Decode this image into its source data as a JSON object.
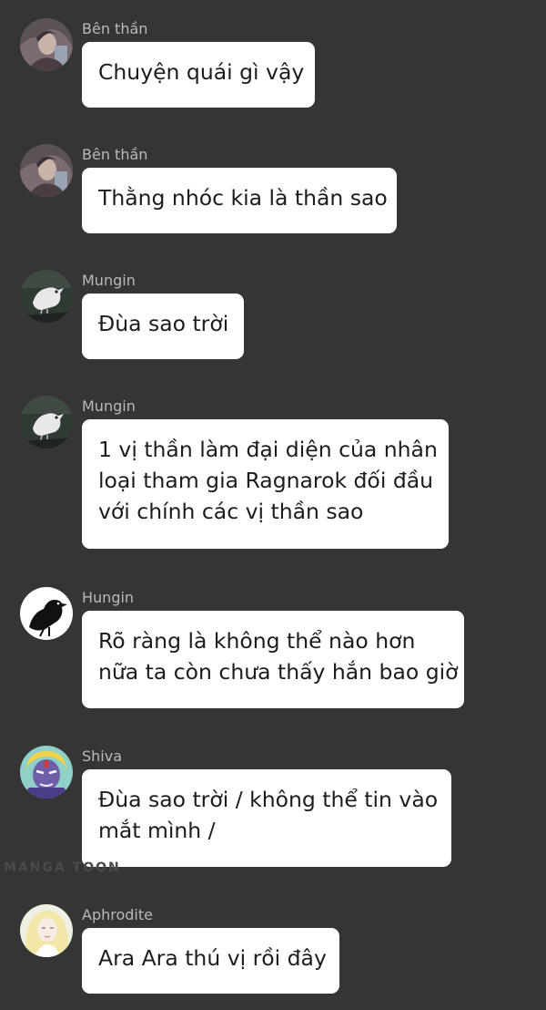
{
  "messages": [
    {
      "sender": "Bên thần",
      "avatar_icon": "hooded-figure-avatar-icon",
      "lines": [
        "Chuyện quái gì vậy"
      ]
    },
    {
      "sender": "Bên thần",
      "avatar_icon": "hooded-figure-avatar-icon",
      "lines": [
        "Thằng nhóc kia là thần sao"
      ]
    },
    {
      "sender": "Mungin",
      "avatar_icon": "white-raven-avatar-icon",
      "lines": [
        "Đùa sao trời"
      ]
    },
    {
      "sender": "Mungin",
      "avatar_icon": "white-raven-avatar-icon",
      "lines": [
        "1 vị thần làm đại diện của nhân",
        "loại tham gia Ragnarok đối đầu",
        "với chính các vị thần sao"
      ]
    },
    {
      "sender": "Hungin",
      "avatar_icon": "black-crow-avatar-icon",
      "lines": [
        "Rõ ràng là không thể nào hơn",
        "nữa ta còn chưa thấy hắn bao giờ"
      ]
    },
    {
      "sender": "Shiva",
      "avatar_icon": "shiva-portrait-avatar-icon",
      "lines": [
        "Đùa sao trời / không thể tin vào",
        "mắt mình /"
      ]
    },
    {
      "sender": "Aphrodite",
      "avatar_icon": "aphrodite-portrait-avatar-icon",
      "lines": [
        "Ara Ara thú vị rồi đây"
      ]
    }
  ],
  "watermark": "MANGA TOON",
  "colors": {
    "background": "#353535",
    "bubble": "#ffffff",
    "sender": "#b9b9b9",
    "text": "#1c1c1c"
  }
}
